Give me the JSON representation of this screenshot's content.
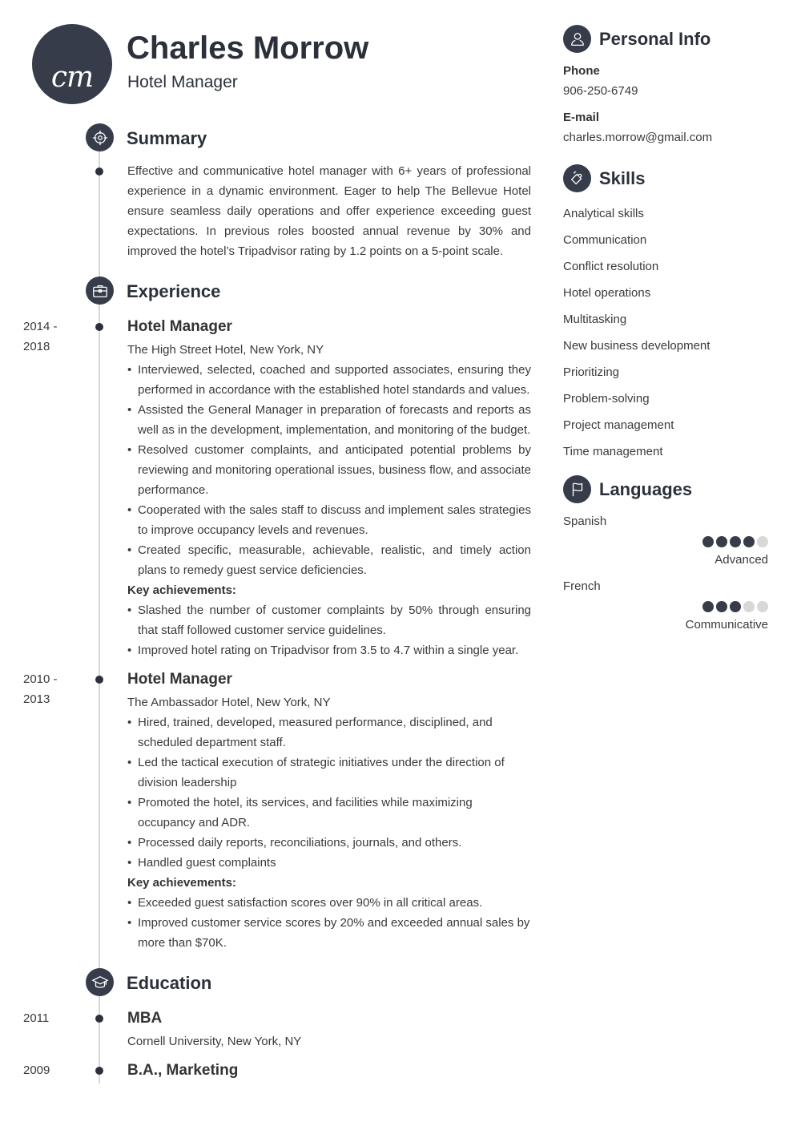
{
  "header": {
    "initials": "cm",
    "name": "Charles Morrow",
    "job_title": "Hotel Manager"
  },
  "colors": {
    "accent": "#363c49",
    "timeline": "#d6d6d6",
    "dot_inactive": "#d8d8d8"
  },
  "summary": {
    "title": "Summary",
    "icon": "target-icon",
    "text": "Effective and communicative hotel manager with 6+ years of professional experience in a dynamic environment. Eager to help The Bellevue Hotel ensure seamless daily operations and offer experience exceeding guest expectations. In previous roles boosted annual revenue by 30% and improved the hotel’s Tripadvisor rating by 1.2 points on a 5-point scale."
  },
  "experience": {
    "title": "Experience",
    "icon": "briefcase-icon",
    "jobs": [
      {
        "date_start": "2014 -",
        "date_end": "2018",
        "title": "Hotel Manager",
        "org": "The High Street Hotel, New York, NY",
        "bullets": [
          "Interviewed, selected, coached and supported associates, ensuring they performed in accordance with the established hotel standards and values.",
          "Assisted the General Manager in preparation of forecasts and reports as well as in the development, implementation, and monitoring of the budget.",
          "Resolved customer complaints, and anticipated potential problems by reviewing and monitoring operational issues, business flow, and associate performance.",
          "Cooperated with the sales staff to discuss and implement sales strategies to improve occupancy levels and revenues.",
          "Created specific, measurable, achievable, realistic, and timely action plans to remedy guest service deficiencies."
        ],
        "achievements_label": "Key achievements:",
        "achievements": [
          "Slashed the number of customer complaints by 50% through ensuring that staff followed customer service guidelines.",
          "Improved hotel rating on Tripadvisor from 3.5 to 4.7 within a single year."
        ]
      },
      {
        "date_start": "2010 -",
        "date_end": "2013",
        "title": "Hotel Manager",
        "org": "The Ambassador Hotel, New York, NY",
        "bullets": [
          "Hired, trained, developed, measured performance, disciplined, and scheduled department staff.",
          "Led the tactical execution of strategic initiatives under the direction of division leadership",
          "Promoted the hotel, its services, and facilities while maximizing occupancy and ADR.",
          "Processed daily reports, reconciliations, journals, and others.",
          "Handled guest complaints"
        ],
        "achievements_label": "Key achievements:",
        "achievements": [
          "Exceeded guest satisfaction scores over 90% in all critical areas.",
          "Improved customer service scores by 20% and exceeded annual sales by more than $70K."
        ]
      }
    ]
  },
  "education": {
    "title": "Education",
    "icon": "graduation-cap-icon",
    "items": [
      {
        "date": "2011",
        "degree": "MBA",
        "school": "Cornell University, New York, NY"
      },
      {
        "date": "2009",
        "degree": "B.A., Marketing"
      }
    ]
  },
  "personal_info": {
    "title": "Personal Info",
    "icon": "user-icon",
    "phone_label": "Phone",
    "phone": "906-250-6749",
    "email_label": "E-mail",
    "email": "charles.morrow@gmail.com"
  },
  "skills": {
    "title": "Skills",
    "icon": "puzzle-icon",
    "items": [
      "Analytical skills",
      "Communication",
      "Conflict resolution",
      "Hotel operations",
      "Multitasking",
      "New business development",
      "Prioritizing",
      "Problem-solving",
      "Project management",
      "Time management"
    ]
  },
  "languages": {
    "title": "Languages",
    "icon": "flag-icon",
    "items": [
      {
        "name": "Spanish",
        "rating": 4,
        "max": 5,
        "level": "Advanced"
      },
      {
        "name": "French",
        "rating": 3,
        "max": 5,
        "level": "Communicative"
      }
    ]
  }
}
